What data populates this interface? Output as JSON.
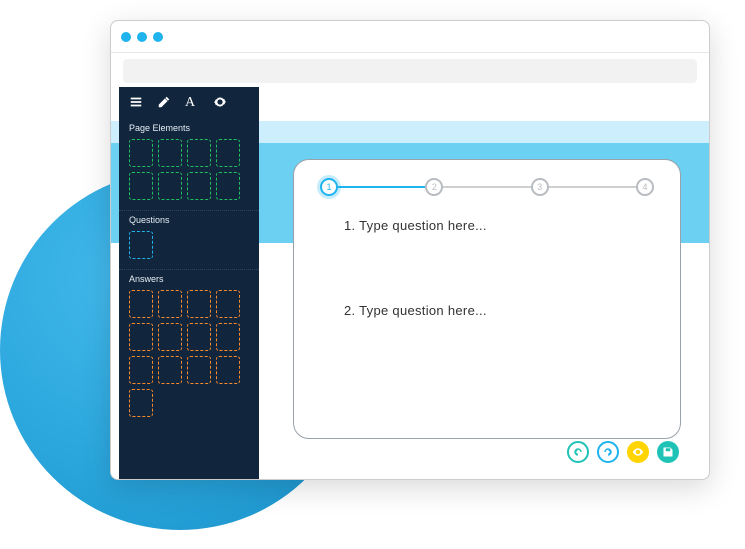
{
  "sidebar": {
    "sections": {
      "pageElements": {
        "title": "Page Elements"
      },
      "questions": {
        "title": "Questions"
      },
      "answers": {
        "title": "Answers"
      }
    }
  },
  "stepper": {
    "steps": [
      {
        "n": "1",
        "active": true
      },
      {
        "n": "2",
        "active": false
      },
      {
        "n": "3",
        "active": false
      },
      {
        "n": "4",
        "active": false
      }
    ]
  },
  "questions": [
    {
      "text": "1. Type question here..."
    },
    {
      "text": "2. Type question here..."
    }
  ],
  "icons": {
    "list": "list-icon",
    "edit": "edit-icon",
    "font": "A",
    "gear": "gear-icon",
    "undo": "undo-icon",
    "redo": "redo-icon",
    "eye": "eye-icon",
    "save": "save-icon"
  },
  "colors": {
    "accent": "#1fb4ee",
    "teal": "#1fc3b6",
    "yellow": "#ffd400",
    "navy": "#11263c"
  }
}
